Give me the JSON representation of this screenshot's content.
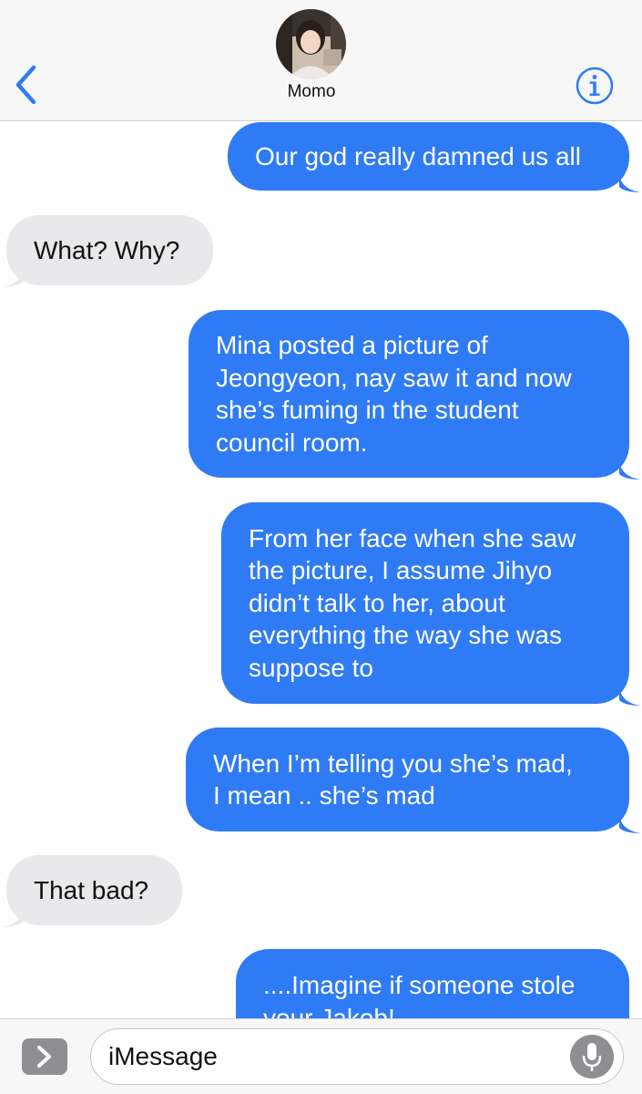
{
  "header": {
    "contact_name": "Momo"
  },
  "messages": [
    {
      "direction": "sent",
      "text": "Our god really damned us all"
    },
    {
      "direction": "received",
      "text": "What? Why?"
    },
    {
      "direction": "sent",
      "text": "Mina posted a picture of\nJeongyeon, nay saw it and now\nshe’s fuming in the student\ncouncil room."
    },
    {
      "direction": "sent",
      "text": "From her face when she saw\nthe picture, I assume Jihyo\ndidn’t talk to her, about\neverything the way she was\nsuppose to"
    },
    {
      "direction": "sent",
      "text": "When I’m telling you she’s mad,\nI mean .. she’s mad"
    },
    {
      "direction": "received",
      "text": "That bad?"
    },
    {
      "direction": "sent",
      "text": "....Imagine if someone stole\nyour Jakob!"
    }
  ],
  "input": {
    "placeholder": "iMessage"
  },
  "colors": {
    "sent_bubble": "#2f7bf5",
    "received_bubble": "#e9e9eb",
    "accent": "#2f7bf5"
  },
  "icons": {
    "back": "chevron-left-icon",
    "info": "info-icon",
    "apps": "chevron-right-icon",
    "mic": "microphone-icon"
  }
}
